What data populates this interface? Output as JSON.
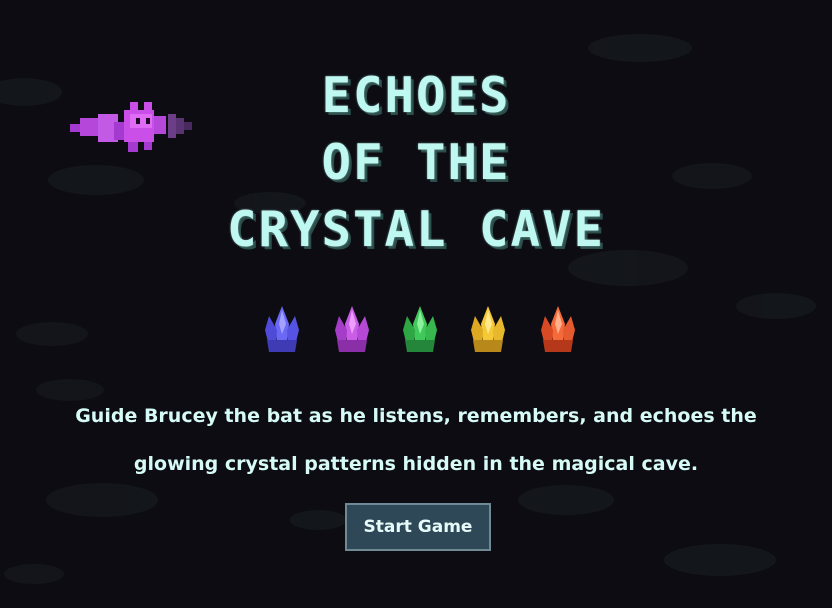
{
  "title": {
    "line1": "ECHOES",
    "line2": "OF THE",
    "line3": "CRYSTAL CAVE"
  },
  "crystals": [
    {
      "name": "blue",
      "color": "#5f5cf0"
    },
    {
      "name": "purple",
      "color": "#c04ce0"
    },
    {
      "name": "green",
      "color": "#3ac04a"
    },
    {
      "name": "yellow",
      "color": "#f0c030"
    },
    {
      "name": "red",
      "color": "#f05a30"
    }
  ],
  "description": "Guide Brucey the bat as he listens, remembers, and echoes the glowing crystal patterns hidden in the magical cave.",
  "start_button": {
    "label": "Start Game"
  },
  "colors": {
    "background": "#0c0c12",
    "title": "#bff7f1",
    "text": "#d6faf6",
    "button_bg": "#2f4857",
    "button_border": "#6f8a94",
    "bat": "#c94fe8"
  }
}
